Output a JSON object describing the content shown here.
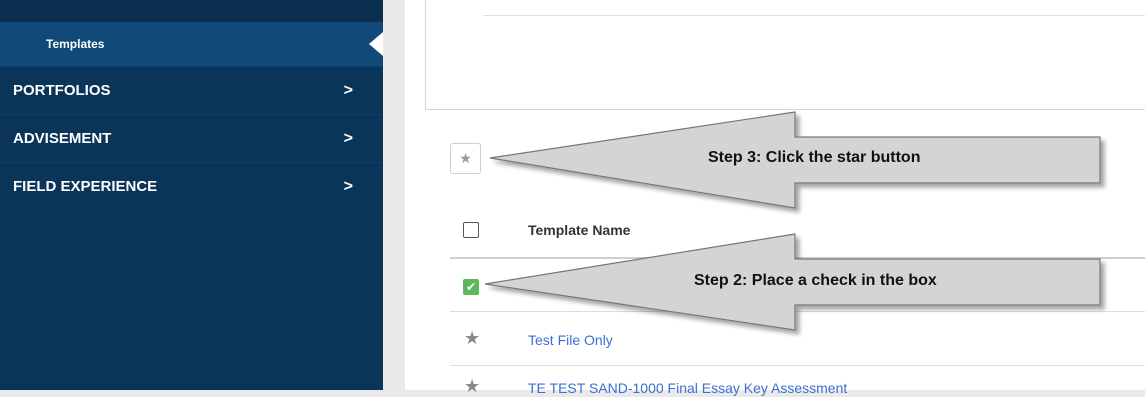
{
  "sidebar": {
    "sub_item": "Templates",
    "items": [
      {
        "label": "PORTFOLIOS",
        "chevron": ">"
      },
      {
        "label": "ADVISEMENT",
        "chevron": ">"
      },
      {
        "label": "FIELD EXPERIENCE",
        "chevron": ">"
      }
    ]
  },
  "toolbar": {
    "star_icon": "★"
  },
  "table": {
    "header": "Template Name",
    "check_mark": "✔",
    "rows": [
      {
        "name": "Test File Only",
        "star": "★"
      },
      {
        "name": "TE TEST SAND-1000 Final Essay Key Assessment",
        "star": "★"
      }
    ]
  },
  "callouts": {
    "step3": "Step 3: Click the star button",
    "step2": "Step 2: Place a check in the box"
  },
  "colors": {
    "sidebar": "#0b3558",
    "sidebar_active": "#114a79",
    "link": "#3b6fd1",
    "checked": "#5cb85c",
    "callout_fill": "#d4d4d4"
  }
}
